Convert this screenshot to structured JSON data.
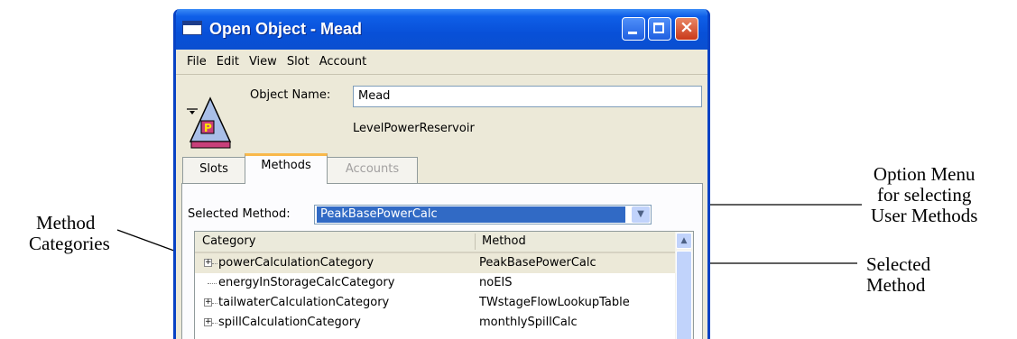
{
  "window": {
    "title": "Open Object - Mead",
    "controls": {
      "minimize": "minimize",
      "maximize": "maximize",
      "close": "×"
    }
  },
  "menu": [
    "File",
    "Edit",
    "View",
    "Slot",
    "Account"
  ],
  "object": {
    "name_label": "Object Name:",
    "name_value": "Mead",
    "type": "LevelPowerReservoir",
    "icon_letter": "P"
  },
  "tabs": [
    {
      "label": "Slots",
      "state": "normal"
    },
    {
      "label": "Methods",
      "state": "active"
    },
    {
      "label": "Accounts",
      "state": "disabled"
    }
  ],
  "selected_method": {
    "label": "Selected Method:",
    "value": "PeakBasePowerCalc"
  },
  "table": {
    "columns": [
      "Category",
      "Method"
    ],
    "rows": [
      {
        "category": "powerCalculationCategory",
        "method": "PeakBasePowerCalc",
        "expandable": true,
        "selected": true
      },
      {
        "category": "energyInStorageCalcCategory",
        "method": "noEIS",
        "expandable": false,
        "selected": false
      },
      {
        "category": "tailwaterCalculationCategory",
        "method": "TWstageFlowLookupTable",
        "expandable": true,
        "selected": false
      },
      {
        "category": "spillCalculationCategory",
        "method": "monthlySpillCalc",
        "expandable": true,
        "selected": false
      }
    ]
  },
  "annotations": {
    "method_categories": [
      "Method",
      "Categories"
    ],
    "option_menu": [
      "Option Menu",
      "for selecting",
      "User Methods"
    ],
    "selected_method": [
      "Selected",
      "Method"
    ]
  },
  "colors": {
    "titlebar": "#0a4fd0",
    "selection": "#316ac5",
    "active_tab_accent": "#f9b84a"
  }
}
